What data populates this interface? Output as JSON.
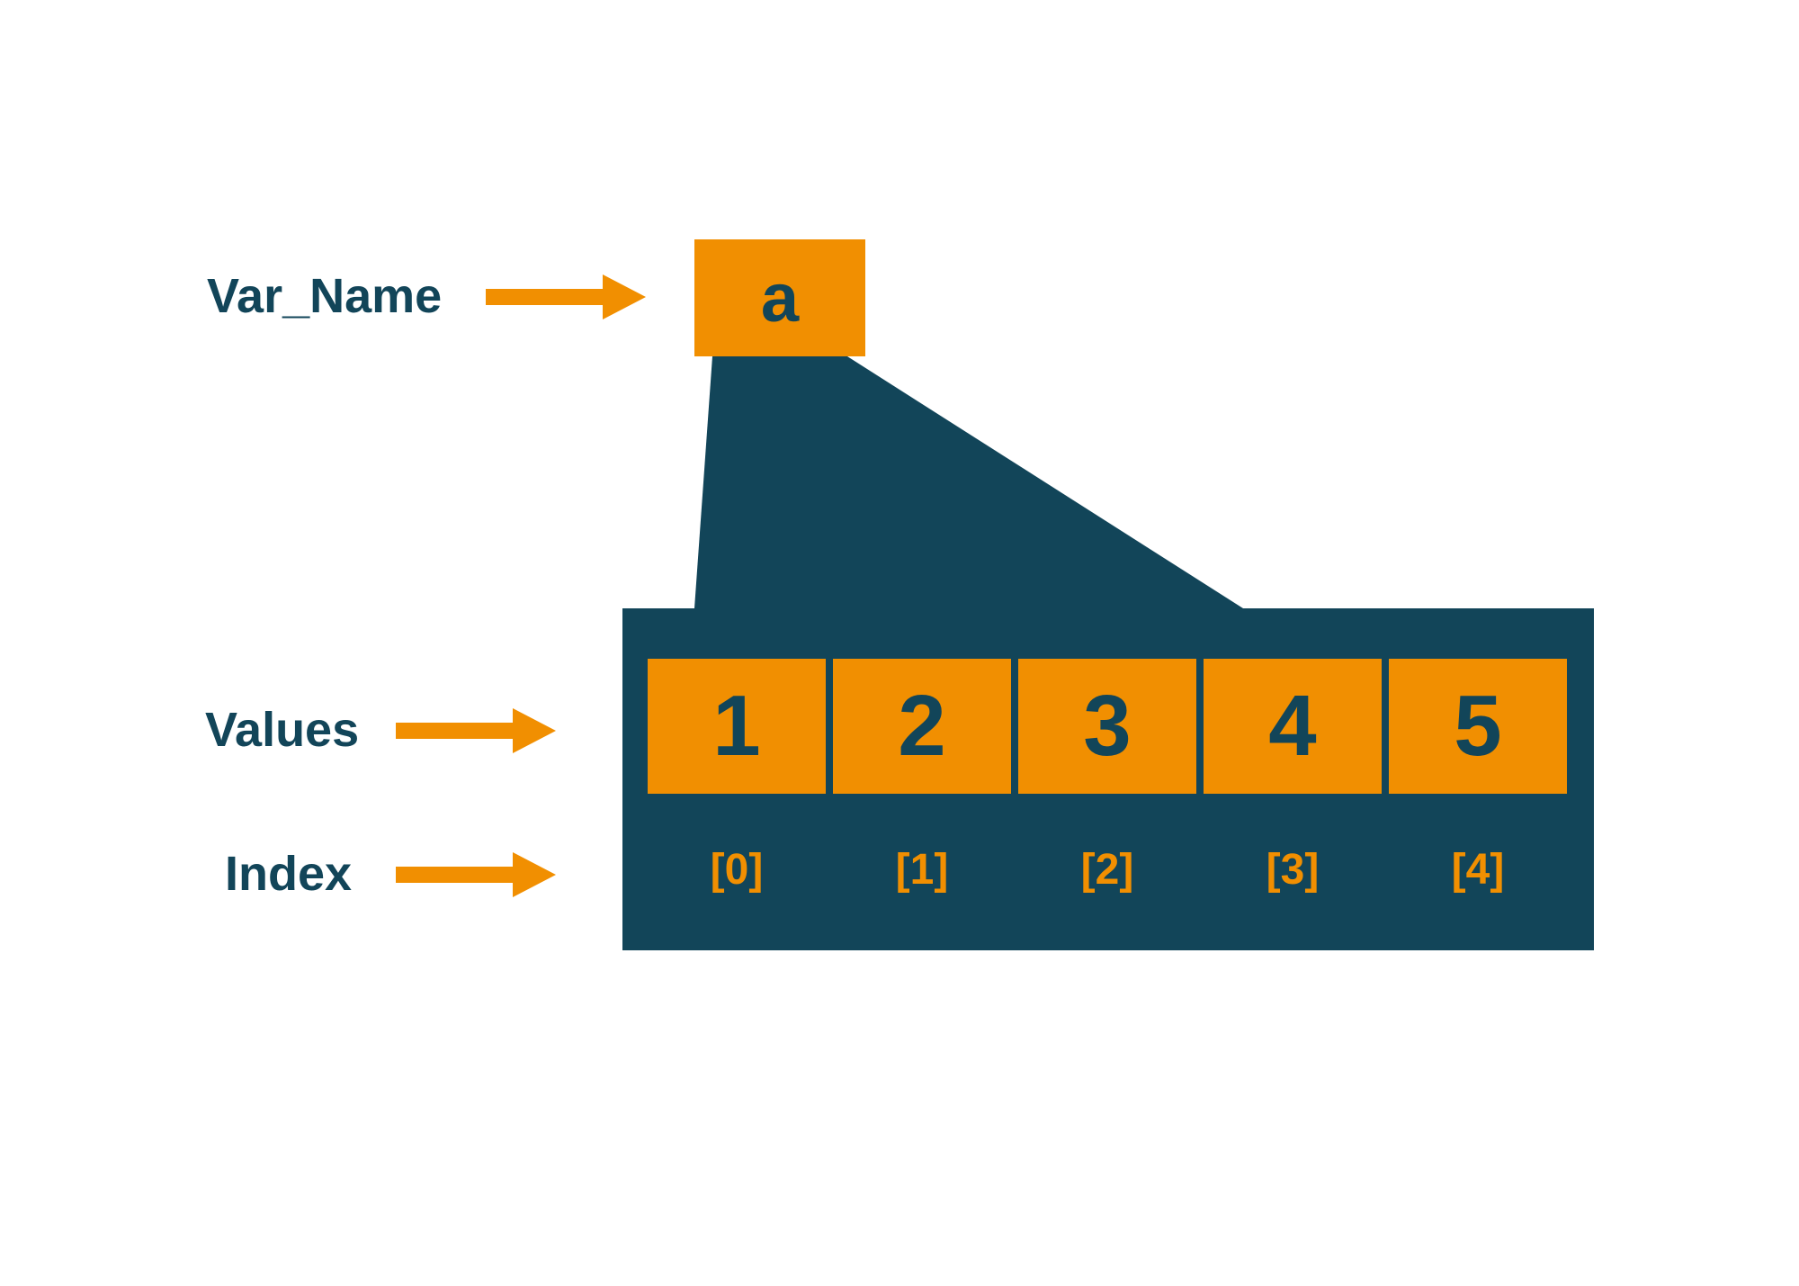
{
  "labels": {
    "var_name": "Var_Name",
    "values": "Values",
    "index": "Index"
  },
  "variable_name": "a",
  "array": {
    "values": [
      "1",
      "2",
      "3",
      "4",
      "5"
    ],
    "indices": [
      "[0]",
      "[1]",
      "[2]",
      "[3]",
      "[4]"
    ]
  },
  "colors": {
    "orange": "#f18f01",
    "dark": "#124559"
  }
}
